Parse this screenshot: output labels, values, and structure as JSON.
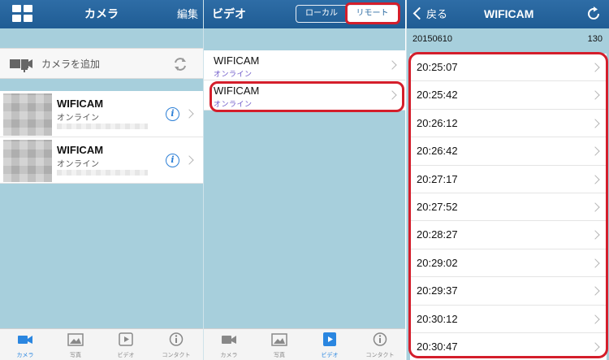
{
  "panel_camera": {
    "title": "カメラ",
    "edit_label": "編集",
    "add_camera_label": "カメラを追加",
    "cameras": [
      {
        "name": "WIFICAM",
        "status": "オンライン"
      },
      {
        "name": "WIFICAM",
        "status": "オンライン"
      }
    ]
  },
  "panel_video": {
    "title": "ビデオ",
    "segment_local": "ローカル",
    "segment_remote": "リモート",
    "items": [
      {
        "name": "WIFICAM",
        "status": "オンライン"
      },
      {
        "name": "WIFICAM",
        "status": "オンライン"
      }
    ]
  },
  "panel_files": {
    "back_label": "戻る",
    "title": "WIFICAM",
    "date": "20150610",
    "count": "130",
    "times": [
      "20:25:07",
      "20:25:42",
      "20:26:12",
      "20:26:42",
      "20:27:17",
      "20:27:52",
      "20:28:27",
      "20:29:02",
      "20:29:37",
      "20:30:12",
      "20:30:47"
    ]
  },
  "tabs": [
    {
      "label": "カメラ",
      "icon": "camera-icon"
    },
    {
      "label": "写真",
      "icon": "photo-icon"
    },
    {
      "label": "ビデオ",
      "icon": "video-icon"
    },
    {
      "label": "コンタクト",
      "icon": "info-icon"
    }
  ],
  "colors": {
    "navbar": "#2166a0",
    "accent": "#2a86e0",
    "highlight_red": "#d41e2b",
    "background": "#a7cfdc"
  }
}
